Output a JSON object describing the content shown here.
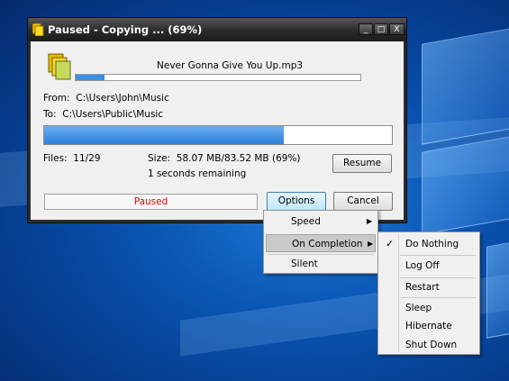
{
  "window": {
    "title": "Paused - Copying ... (69%)",
    "filename": "Never Gonna Give You Up.mp3",
    "from_label": "From:",
    "from_path": "C:\\Users\\John\\Music",
    "to_label": "To:",
    "to_path": "C:\\Users\\Public\\Music",
    "file_progress": 0.1,
    "total_progress": 0.69,
    "files_label": "Files:",
    "files_value": "11/29",
    "size_label": "Size:",
    "size_value": "58.07 MB/83.52 MB (69%)",
    "remaining": "1 seconds remaining",
    "status": "Paused",
    "status_color": "#e00000",
    "buttons": {
      "resume": "Resume",
      "options": "Options",
      "cancel": "Cancel"
    },
    "caption_buttons": {
      "minimize": "_",
      "maximize": "□",
      "close": "X"
    }
  },
  "options_menu": {
    "items": [
      {
        "label": "Speed",
        "has_submenu": true
      },
      {
        "label": "On Completion",
        "has_submenu": true,
        "highlighted": true
      },
      {
        "label": "Silent",
        "has_submenu": false
      }
    ]
  },
  "completion_menu": {
    "items": [
      {
        "label": "Do Nothing",
        "checked": true
      },
      {
        "label": "Log Off"
      },
      {
        "label": "Restart"
      },
      {
        "label": "Sleep"
      },
      {
        "label": "Hibernate"
      },
      {
        "label": "Shut Down"
      }
    ]
  },
  "colors": {
    "progress": "#3a8ee6",
    "highlight": "#c9c9c9",
    "accent": "#2a6fd6"
  }
}
